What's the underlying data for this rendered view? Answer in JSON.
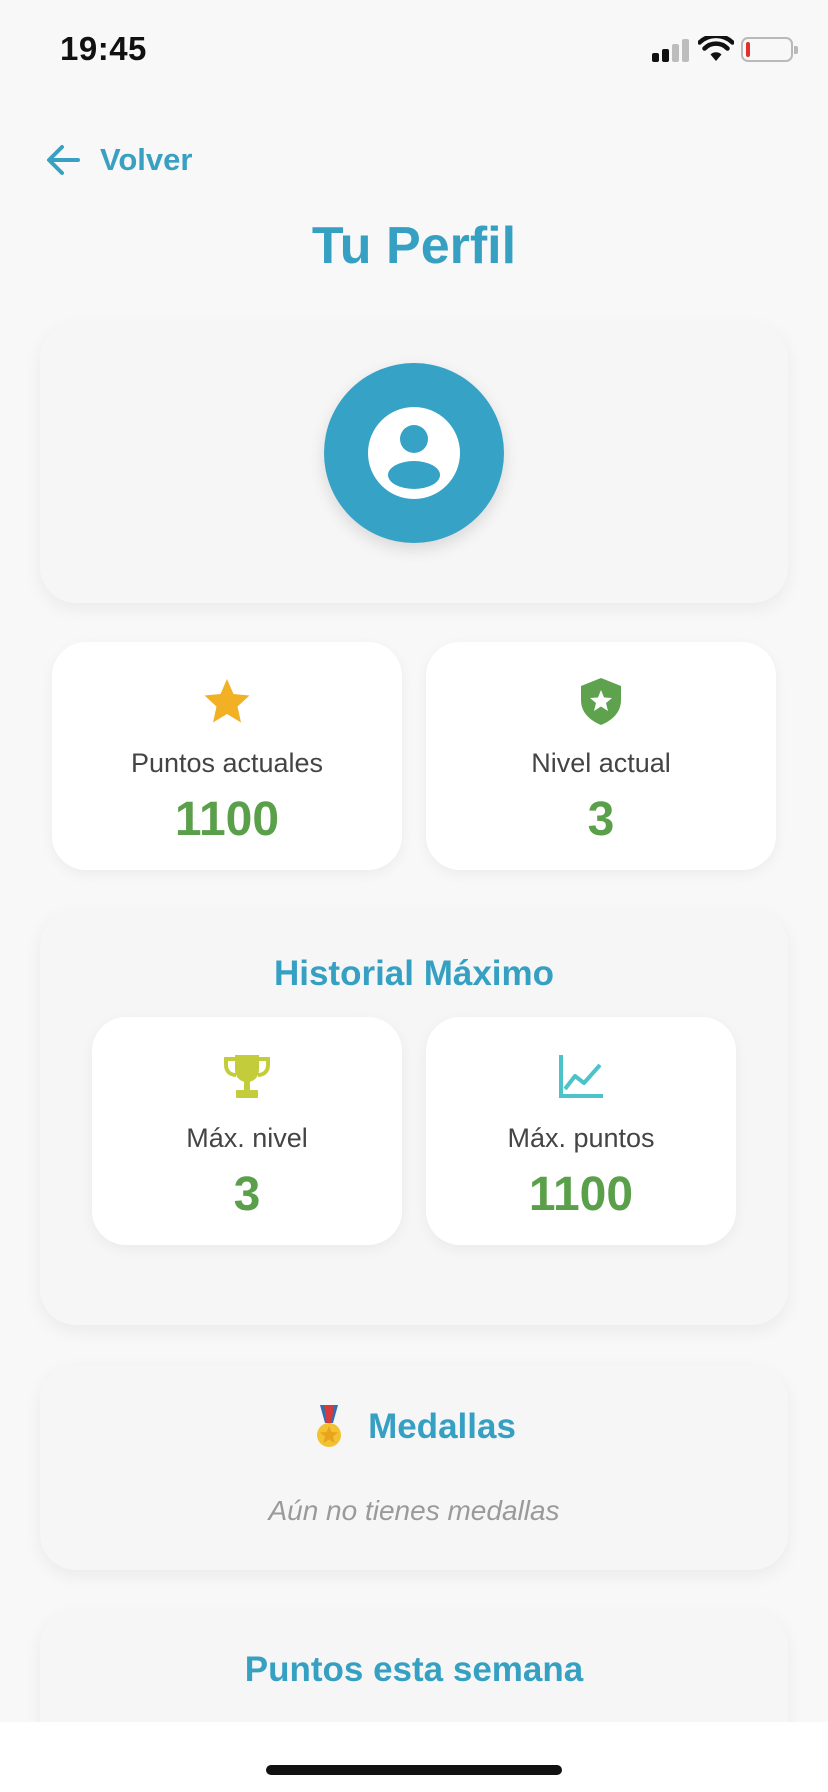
{
  "status_bar": {
    "time": "19:45"
  },
  "nav": {
    "back_label": "Volver"
  },
  "page": {
    "title": "Tu Perfil"
  },
  "stats": {
    "current_points": {
      "icon": "star-icon",
      "label": "Puntos actuales",
      "value": "1100"
    },
    "current_level": {
      "icon": "shield-star-icon",
      "label": "Nivel actual",
      "value": "3"
    }
  },
  "history": {
    "title": "Historial Máximo",
    "max_level": {
      "icon": "trophy-icon",
      "label": "Máx. nivel",
      "value": "3"
    },
    "max_points": {
      "icon": "line-chart-icon",
      "label": "Máx. puntos",
      "value": "1100"
    }
  },
  "medals": {
    "icon": "medal-icon",
    "title": "Medallas",
    "empty_text": "Aún no tienes medallas"
  },
  "week": {
    "title": "Puntos esta semana"
  },
  "colors": {
    "accent": "#36a0c3",
    "value_green": "#5a9f4a",
    "star": "#f2b024",
    "shield": "#5ea24e",
    "trophy": "#c3cd3b",
    "chart": "#4cc2c9",
    "background": "#f8f8f8"
  }
}
